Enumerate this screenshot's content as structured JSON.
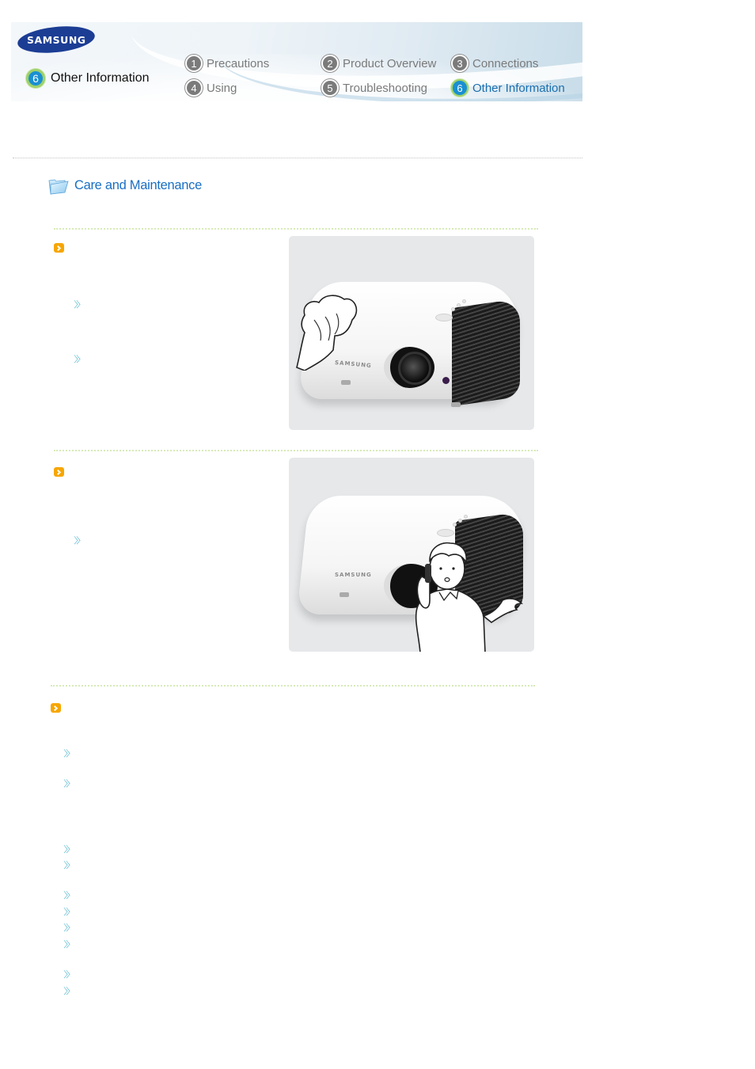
{
  "header": {
    "brand": "SAMSUNG",
    "current_section": {
      "number": "6",
      "label": "Other Information"
    },
    "nav": [
      {
        "number": "1",
        "label": "Precautions",
        "active": false
      },
      {
        "number": "2",
        "label": "Product Overview",
        "active": false
      },
      {
        "number": "3",
        "label": "Connections",
        "active": false
      },
      {
        "number": "4",
        "label": "Using",
        "active": false
      },
      {
        "number": "5",
        "label": "Troubleshooting",
        "active": false
      },
      {
        "number": "6",
        "label": "Other Information",
        "active": true
      }
    ]
  },
  "page": {
    "title": "Care and Maintenance",
    "title_icon": "folder-icon"
  },
  "illustrations": [
    {
      "name": "projector-cleaning-illustration",
      "brand_text": "SAMSUNG",
      "description": "Hand wiping projector with cloth"
    },
    {
      "name": "projector-service-illustration",
      "brand_text": "SAMSUNG",
      "description": "Man on phone shrugging next to projector"
    }
  ],
  "sections": [
    {
      "bullet_icon": "orange-arrow-icon",
      "sub_bullet_count": 2
    },
    {
      "bullet_icon": "orange-arrow-icon",
      "sub_bullet_count": 1
    },
    {
      "bullet_icon": "orange-arrow-icon",
      "sub_bullet_count": 10
    }
  ],
  "colors": {
    "brand_blue": "#1c3d94",
    "title_blue": "#1a6fc4",
    "active_nav": "#1a6fb0",
    "inactive_nav": "#7a7a7a",
    "orange_bullet": "#f7a600",
    "blue_bullet": "#5bb8cf",
    "green_divider": "#d7ebb8"
  }
}
